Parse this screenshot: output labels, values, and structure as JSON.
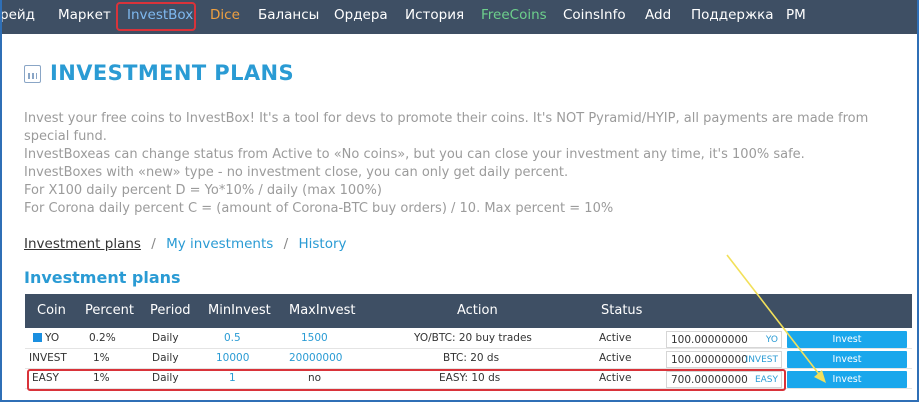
{
  "nav": {
    "items": [
      {
        "label": "рейд",
        "style": "normal"
      },
      {
        "label": "Маркет",
        "style": "normal"
      },
      {
        "label": "InvestBox",
        "style": "active"
      },
      {
        "label": "Dice",
        "style": "orange"
      },
      {
        "label": "Балансы",
        "style": "normal"
      },
      {
        "label": "Ордера",
        "style": "normal"
      },
      {
        "label": "История",
        "style": "normal"
      },
      {
        "label": "FreeCoins",
        "style": "green"
      },
      {
        "label": "CoinsInfo",
        "style": "normal"
      },
      {
        "label": "Add",
        "style": "normal"
      },
      {
        "label": "Поддержка",
        "style": "normal"
      },
      {
        "label": "PM",
        "style": "normal"
      }
    ]
  },
  "page": {
    "title": "INVESTMENT PLANS",
    "title_icon": "chart-icon",
    "description": [
      "Invest your free coins to InvestBox! It's a tool for devs to promote their coins. It's NOT Pyramid/HYIP, all payments are made from special fund.",
      "InvestBoxeas can change status from Active to «No coins», but you can close your investment any time, it's 100% safe.",
      "InvestBoxes with «new» type - no investment close, you can only get daily percent.",
      "For X100 daily percent D = Yo*10% / daily (max 100%)",
      "For Corona daily percent C = (amount of Corona-BTC buy orders) / 10. Max percent = 10%"
    ]
  },
  "subnav": {
    "current": "Investment plans",
    "separator": "/",
    "links": [
      "My investments",
      "History"
    ]
  },
  "section_title": "Investment plans",
  "table": {
    "columns": [
      "Coin",
      "Percent",
      "Period",
      "MinInvest",
      "MaxInvest",
      "Action",
      "Status"
    ],
    "rows": [
      {
        "coin": "YO",
        "percent": "0.2%",
        "period": "Daily",
        "min": "0.5",
        "max": "1500",
        "action": "YO/BTC: 20 buy trades",
        "status": "Active",
        "amount": "100.00000000",
        "currency": "YO",
        "button": "Invest"
      },
      {
        "coin": "INVEST",
        "percent": "1%",
        "period": "Daily",
        "min": "10000",
        "max": "20000000",
        "action": "BTC: 20 ds",
        "status": "Active",
        "amount": "100.00000000",
        "currency": "INVEST",
        "button": "Invest"
      },
      {
        "coin": "EASY",
        "percent": "1%",
        "period": "Daily",
        "min": "1",
        "max": "no",
        "action": "EASY: 10 ds",
        "status": "Active",
        "amount": "700.00000000",
        "currency": "EASY",
        "button": "Invest"
      }
    ]
  },
  "colors": {
    "nav_bg": "#3e4f64",
    "accent": "#2a9bd4",
    "highlight": "#d9333a",
    "button": "#1aa7ec",
    "annotation_arrow": "#f2e05a"
  }
}
